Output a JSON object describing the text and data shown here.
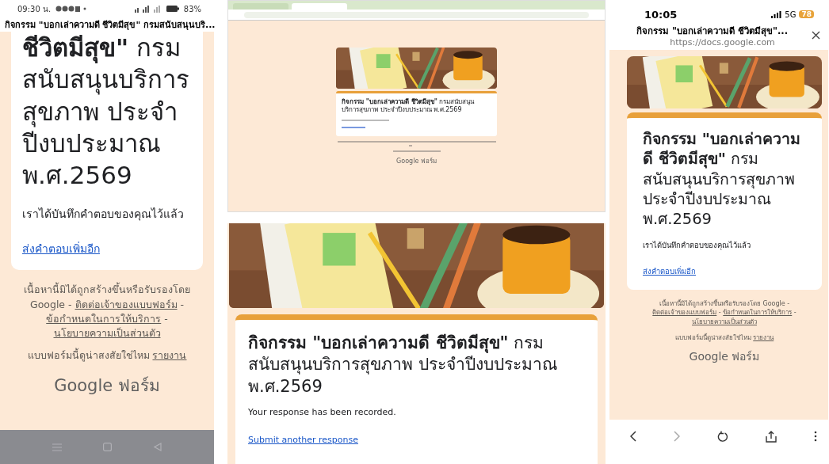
{
  "left_phone": {
    "status_bar": {
      "time": "09:30 น.",
      "battery": "83%"
    },
    "page_title": "กิจกรรม \"บอกเล่าความดี ชีวิตมีสุข\" กรมสนับสนุนบริ...",
    "form": {
      "title": "**ชีวิตมีสุข\"** กรมสนับสนุนบริการสุขภาพ ประจำปีงบประมาณ พ.ศ.2569",
      "message": "เราได้บันทึกคำตอบของคุณไว้แล้ว",
      "link": "ส่งคำตอบเพิ่มอีก"
    },
    "footer": {
      "notice": [
        {
          "kind": "text",
          "text": "เนื้อหานี้มิได้ถูกสร้างขึ้นหรือรับรองโดย Google - "
        },
        {
          "kind": "link",
          "text": "ติดต่อเจ้าของแบบฟอร์ม"
        },
        {
          "kind": "text",
          "text": " - "
        },
        {
          "kind": "link",
          "text": "ข้อกำหนดในการให้บริการ"
        },
        {
          "kind": "text",
          "text": " - "
        },
        {
          "kind": "link",
          "text": "นโยบายความเป็นส่วนตัว"
        }
      ],
      "report": [
        {
          "kind": "text",
          "text": "แบบฟอร์มนี้ดูน่าสงสัยใช่ไหม "
        },
        {
          "kind": "link",
          "text": "รายงาน"
        }
      ],
      "logo": "Google ฟอร์ม"
    }
  },
  "browser_window": {
    "form": {
      "title": "**กิจกรรม \"บอกเล่าความดี ชีวิตมีสุข\"** กรมสนับสนุนบริการสุขภาพ ประจำปีงบประมาณ พ.ศ.2569"
    },
    "footer": {
      "logo": "Google ฟอร์ม"
    }
  },
  "desktop_form": {
    "form": {
      "title": "**กิจกรรม \"บอกเล่าความดี ชีวิตมีสุข\"** กรมสนับสนุนบริการสุขภาพ ประจำปีงบประมาณ พ.ศ.2569",
      "message": "Your response has been recorded.",
      "link": "Submit another response"
    }
  },
  "right_phone": {
    "status_bar": {
      "time": "10:05",
      "network": "5G",
      "battery": "78"
    },
    "page_title": "กิจกรรม \"บอกเล่าความดี ชีวิตมีสุข\"...",
    "url": "https://docs.google.com",
    "form": {
      "title": "**กิจกรรม \"บอกเล่าความดี ชีวิตมีสุข\"** กรมสนับสนุนบริการสุขภาพ ประจำปีงบประมาณ พ.ศ.2569",
      "message": "เราได้บันทึกคำตอบของคุณไว้แล้ว",
      "link": "ส่งคำตอบเพิ่มอีก"
    },
    "footer": {
      "notice": [
        {
          "kind": "text",
          "text": "เนื้อหานี้มิได้ถูกสร้างขึ้นหรือรับรองโดย Google - "
        },
        {
          "kind": "link",
          "text": "ติดต่อเจ้าของแบบฟอร์ม"
        },
        {
          "kind": "text",
          "text": " - "
        },
        {
          "kind": "link",
          "text": "ข้อกำหนดในการให้บริการ"
        },
        {
          "kind": "text",
          "text": " - "
        },
        {
          "kind": "link",
          "text": "นโยบายความเป็นส่วนตัว"
        }
      ],
      "report": [
        {
          "kind": "text",
          "text": "แบบฟอร์มนี้ดูน่าสงสัยใช่ไหม "
        },
        {
          "kind": "link",
          "text": "รายงาน"
        }
      ],
      "logo": "Google ฟอร์ม"
    }
  }
}
